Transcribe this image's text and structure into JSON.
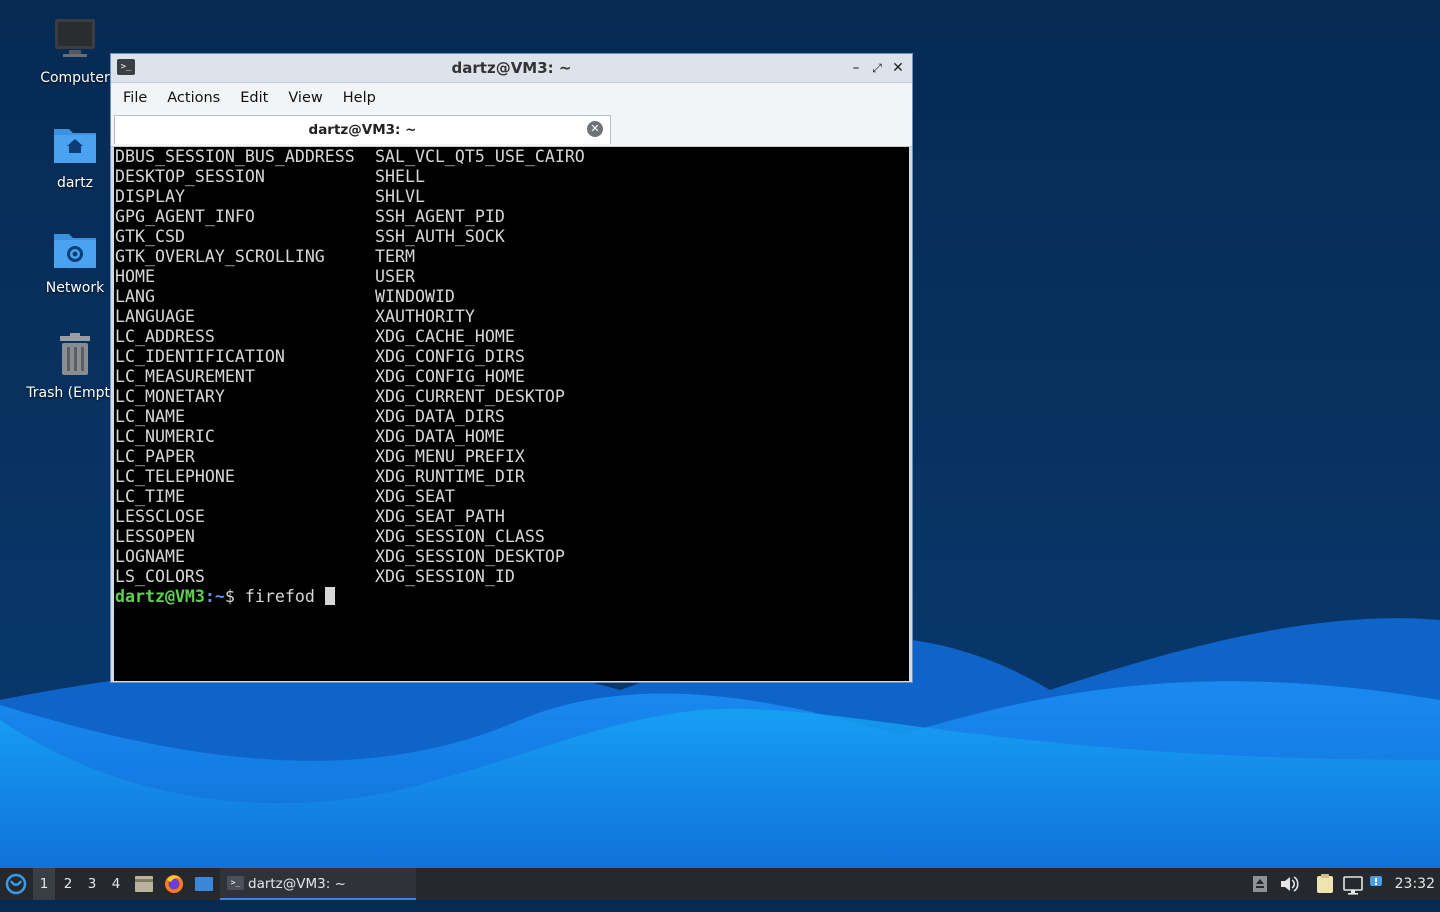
{
  "desktop": {
    "icons": [
      {
        "label": "Computer",
        "icon": "computer-icon"
      },
      {
        "label": "dartz",
        "icon": "home-folder-icon"
      },
      {
        "label": "Network",
        "icon": "network-folder-icon"
      },
      {
        "label": "Trash (Empty)",
        "icon": "trash-icon"
      }
    ]
  },
  "window": {
    "title": "dartz@VM3: ~",
    "menu": [
      "File",
      "Actions",
      "Edit",
      "View",
      "Help"
    ],
    "tab": {
      "title": "dartz@VM3: ~"
    }
  },
  "terminal": {
    "col1": [
      "DBUS_SESSION_BUS_ADDRESS",
      "DESKTOP_SESSION",
      "DISPLAY",
      "GPG_AGENT_INFO",
      "GTK_CSD",
      "GTK_OVERLAY_SCROLLING",
      "HOME",
      "LANG",
      "LANGUAGE",
      "LC_ADDRESS",
      "LC_IDENTIFICATION",
      "LC_MEASUREMENT",
      "LC_MONETARY",
      "LC_NAME",
      "LC_NUMERIC",
      "LC_PAPER",
      "LC_TELEPHONE",
      "LC_TIME",
      "LESSCLOSE",
      "LESSOPEN",
      "LOGNAME",
      "LS_COLORS"
    ],
    "col2": [
      "SAL_VCL_QT5_USE_CAIRO",
      "SHELL",
      "SHLVL",
      "SSH_AGENT_PID",
      "SSH_AUTH_SOCK",
      "TERM",
      "USER",
      "WINDOWID",
      "XAUTHORITY",
      "XDG_CACHE_HOME",
      "XDG_CONFIG_DIRS",
      "XDG_CONFIG_HOME",
      "XDG_CURRENT_DESKTOP",
      "XDG_DATA_DIRS",
      "XDG_DATA_HOME",
      "XDG_MENU_PREFIX",
      "XDG_RUNTIME_DIR",
      "XDG_SEAT",
      "XDG_SEAT_PATH",
      "XDG_SESSION_CLASS",
      "XDG_SESSION_DESKTOP",
      "XDG_SESSION_ID"
    ],
    "prompt_user": "dartz@VM3",
    "prompt_path": ":~",
    "prompt_symbol": "$ ",
    "command": "firefod "
  },
  "taskbar": {
    "workspaces": [
      "1",
      "2",
      "3",
      "4"
    ],
    "active_workspace": "1",
    "window_button": "dartz@VM3: ~",
    "clock": "23:32"
  },
  "colors": {
    "prompt_user": "#5ed14f",
    "prompt_path": "#6a8fe8",
    "taskbar_accent": "#3a86d8"
  }
}
